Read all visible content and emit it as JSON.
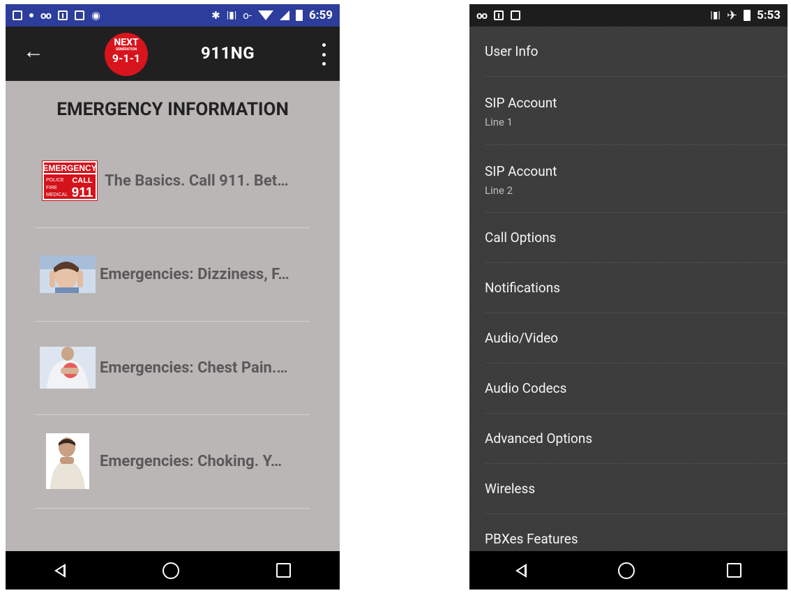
{
  "left_screen": {
    "status_bar": {
      "time": "6:59",
      "left_icons": [
        "image-icon",
        "dot-icon",
        "voicemail-icon",
        "download-icon",
        "photo-check-icon",
        "android-icon"
      ],
      "right_icons": [
        "bluetooth-icon",
        "vibrate-icon",
        "key-icon",
        "wifi-icon",
        "signal-icon",
        "battery-charging-icon"
      ],
      "color": "#2d3d9b"
    },
    "toolbar": {
      "title": "911NG",
      "logo": {
        "line1": "NEXT",
        "line2": "GENERATION",
        "line3": "9-1-1"
      }
    },
    "heading": "EMERGENCY INFORMATION",
    "items": [
      {
        "text": "The Basics.  Call 911. Bet…",
        "thumb": "emergency-sign"
      },
      {
        "text": "Emergencies: Dizziness, F…",
        "thumb": "dizzy-woman"
      },
      {
        "text": "Emergencies: Chest Pain.…",
        "thumb": "chest-pain"
      },
      {
        "text": "Emergencies: Choking.  Y…",
        "thumb": "choking-man"
      }
    ],
    "sign": {
      "top": "EMERGENCY",
      "left1": "POLICE",
      "left2": "FIRE",
      "left3": "MEDICAL",
      "right1": "CALL",
      "right2": "911"
    }
  },
  "right_screen": {
    "status_bar": {
      "time": "5:53",
      "left_icons": [
        "voicemail-icon",
        "download-icon",
        "photo-check-icon"
      ],
      "right_icons": [
        "vibrate-icon",
        "airplane-icon",
        "battery-icon"
      ]
    },
    "items": [
      {
        "title": "User Info"
      },
      {
        "title": "SIP Account",
        "subtitle": "Line 1"
      },
      {
        "title": "SIP Account",
        "subtitle": "Line 2"
      },
      {
        "title": "Call Options"
      },
      {
        "title": "Notifications"
      },
      {
        "title": "Audio/Video"
      },
      {
        "title": "Audio Codecs"
      },
      {
        "title": "Advanced Options"
      },
      {
        "title": "Wireless"
      },
      {
        "title": "PBXes Features"
      }
    ]
  },
  "navigation": [
    "back-button",
    "home-button",
    "recents-button"
  ]
}
